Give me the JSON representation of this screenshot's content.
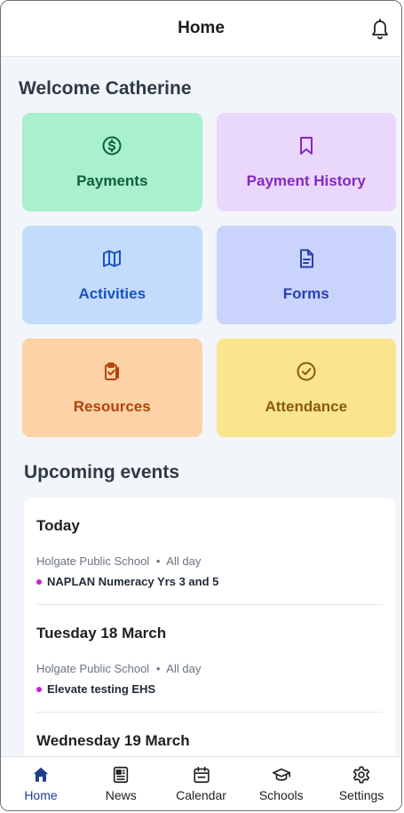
{
  "header": {
    "title": "Home",
    "notification_icon": "bell-icon"
  },
  "welcome": "Welcome Catherine",
  "tiles": [
    {
      "label": "Payments",
      "icon": "dollar-circle-icon"
    },
    {
      "label": "Payment History",
      "icon": "bookmark-icon"
    },
    {
      "label": "Activities",
      "icon": "map-icon"
    },
    {
      "label": "Forms",
      "icon": "document-icon"
    },
    {
      "label": "Resources",
      "icon": "clipboard-icon"
    },
    {
      "label": "Attendance",
      "icon": "check-circle-icon"
    }
  ],
  "upcoming": {
    "heading": "Upcoming events",
    "events": [
      {
        "day": "Today",
        "school": "Holgate Public School",
        "separator": "•",
        "time": "All day",
        "name": "NAPLAN Numeracy Yrs 3 and 5"
      },
      {
        "day": "Tuesday 18 March",
        "school": "Holgate Public School",
        "separator": "•",
        "time": "All day",
        "name": "Elevate testing EHS"
      },
      {
        "day": "Wednesday 19 March"
      }
    ]
  },
  "tabbar": {
    "items": [
      {
        "label": "Home",
        "icon": "home-icon",
        "active": true
      },
      {
        "label": "News",
        "icon": "newspaper-icon"
      },
      {
        "label": "Calendar",
        "icon": "calendar-icon"
      },
      {
        "label": "Schools",
        "icon": "graduation-cap-icon"
      },
      {
        "label": "Settings",
        "icon": "gear-icon"
      }
    ]
  },
  "colors": {
    "event_bullet": "#d01bd9",
    "active_tab": "#1a3d8f"
  }
}
